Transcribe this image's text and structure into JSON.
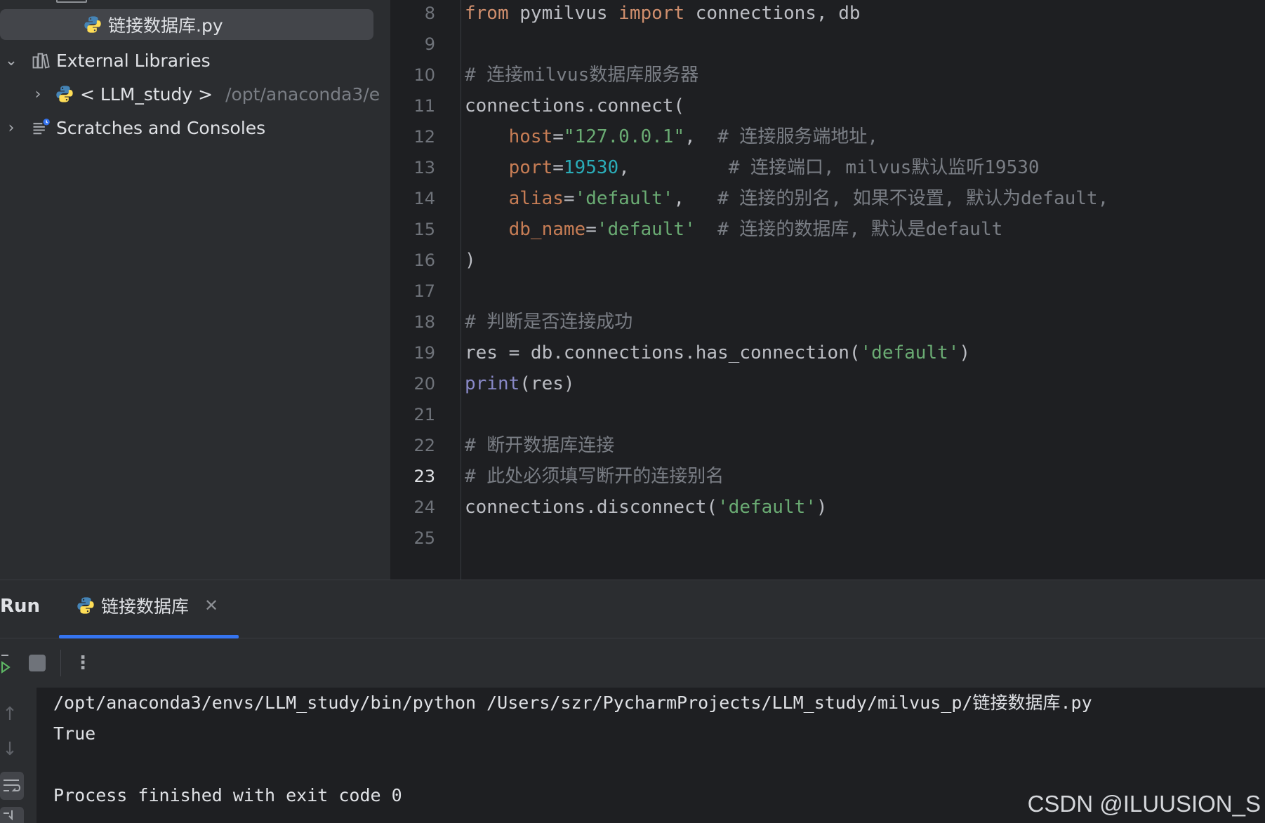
{
  "project_tree": {
    "selected_file": "链接数据库.py",
    "external_libraries": "External Libraries",
    "env_name": "< LLM_study >",
    "env_path": "/opt/anaconda3/e",
    "scratches": "Scratches and Consoles"
  },
  "editor": {
    "current_line": 23,
    "line_numbers": [
      "8",
      "9",
      "10",
      "11",
      "12",
      "13",
      "14",
      "15",
      "16",
      "17",
      "18",
      "19",
      "20",
      "21",
      "22",
      "23",
      "24",
      "25"
    ],
    "code": {
      "l8_kw1": "from",
      "l8_mod": " pymilvus ",
      "l8_kw2": "import",
      "l8_rest": " connections, db",
      "l10": "# 连接milvus数据库服务器",
      "l11": "connections.connect(",
      "l12_param": "host",
      "l12_eq": "=",
      "l12_str": "\"127.0.0.1\"",
      "l12_comma": ",  ",
      "l12_com": "# 连接服务端地址,",
      "l13_param": "port",
      "l13_eq": "=",
      "l13_num": "19530",
      "l13_comma": ",         ",
      "l13_com": "# 连接端口, milvus默认监听19530",
      "l14_param": "alias",
      "l14_eq": "=",
      "l14_str": "'default'",
      "l14_comma": ",   ",
      "l14_com": "# 连接的别名, 如果不设置, 默认为default,",
      "l15_param": "db_name",
      "l15_eq": "=",
      "l15_str": "'default'",
      "l15_comma": "  ",
      "l15_com": "# 连接的数据库, 默认是default",
      "l16": ")",
      "l18": "# 判断是否连接成功",
      "l19_a": "res = db.connections.has_connection(",
      "l19_str": "'default'",
      "l19_b": ")",
      "l20_fn": "print",
      "l20_rest": "(res)",
      "l22": "# 断开数据库连接",
      "l23": "# 此处必须填写断开的连接别名",
      "l24_a": "connections.disconnect(",
      "l24_str": "'default'",
      "l24_b": ")"
    }
  },
  "run": {
    "title": "Run",
    "tab_label": "链接数据库",
    "console_lines": [
      "/opt/anaconda3/envs/LLM_study/bin/python /Users/szr/PycharmProjects/LLM_study/milvus_p/链接数据库.py",
      "True",
      "",
      "Process finished with exit code 0"
    ]
  },
  "watermark": "CSDN @ILUUSION_S",
  "colors": {
    "accent": "#3574f0",
    "keyword": "#cf8e6d",
    "string": "#6aab73",
    "number": "#2aacb8",
    "comment": "#7a7e85"
  }
}
